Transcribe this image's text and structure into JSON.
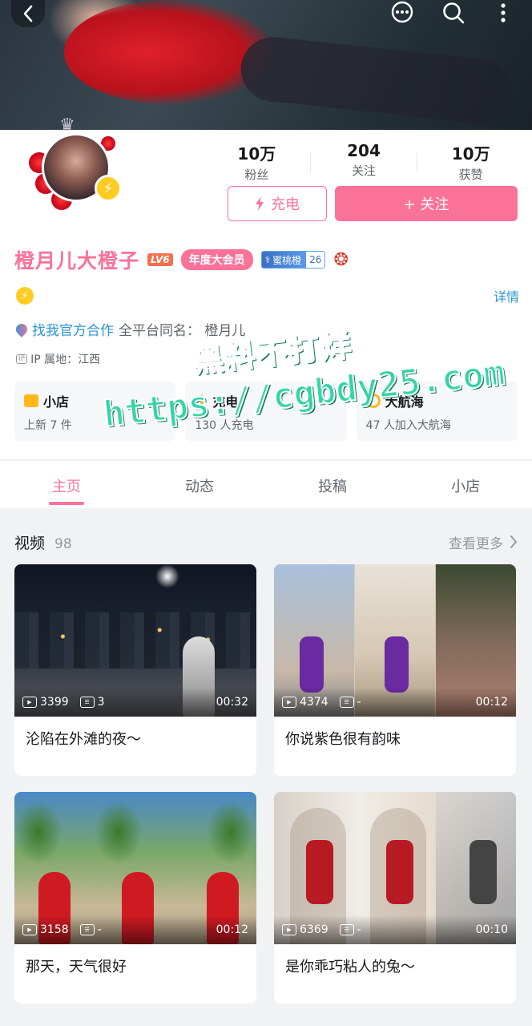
{
  "header": {
    "back_icon": "chevron-left-icon",
    "message_icon": "chat-bubble-icon",
    "search_icon": "search-icon",
    "more_icon": "more-vertical-icon"
  },
  "profile": {
    "stats": [
      {
        "value": "10万",
        "label": "粉丝"
      },
      {
        "value": "204",
        "label": "关注"
      },
      {
        "value": "10万",
        "label": "获赞"
      }
    ],
    "charge_button": "充电",
    "follow_button": "+ 关注",
    "name": "橙月儿大橙子",
    "level": "LV6",
    "vip_badge": "年度大会员",
    "medal_name": "蜜桃橙",
    "medal_level": "26",
    "detail_link": "详情",
    "bio_partner": "找我官方合作",
    "bio_text": "全平台同名：  橙月儿",
    "ip_tag": "IP",
    "ip_location": "IP 属地：江西",
    "cards": [
      {
        "title": "小店",
        "subtitle": "上新 7 件"
      },
      {
        "title": "充电",
        "subtitle": "130 人充电"
      },
      {
        "title": "大航海",
        "subtitle": "47 人加入大航海"
      }
    ]
  },
  "tabs": [
    "主页",
    "动态",
    "投稿",
    "小店"
  ],
  "active_tab": "主页",
  "videos_section": {
    "title": "视频",
    "count": "98",
    "more_label": "查看更多",
    "items": [
      {
        "plays": "3399",
        "danmaku": "3",
        "duration": "00:32",
        "title": "沦陷在外滩的夜～"
      },
      {
        "plays": "4374",
        "danmaku": "-",
        "duration": "00:12",
        "title": "你说紫色很有韵味"
      },
      {
        "plays": "3158",
        "danmaku": "-",
        "duration": "00:12",
        "title": "那天，天气很好"
      },
      {
        "plays": "6369",
        "danmaku": "-",
        "duration": "00:10",
        "title": "是你乖巧粘人的兔～"
      }
    ]
  },
  "watermark": {
    "line1": "黑料不打烊",
    "line2": "https://cgbdy25.com"
  },
  "colors": {
    "accent": "#fb7299",
    "link": "#2b95d6",
    "gold": "#ffcc22"
  }
}
